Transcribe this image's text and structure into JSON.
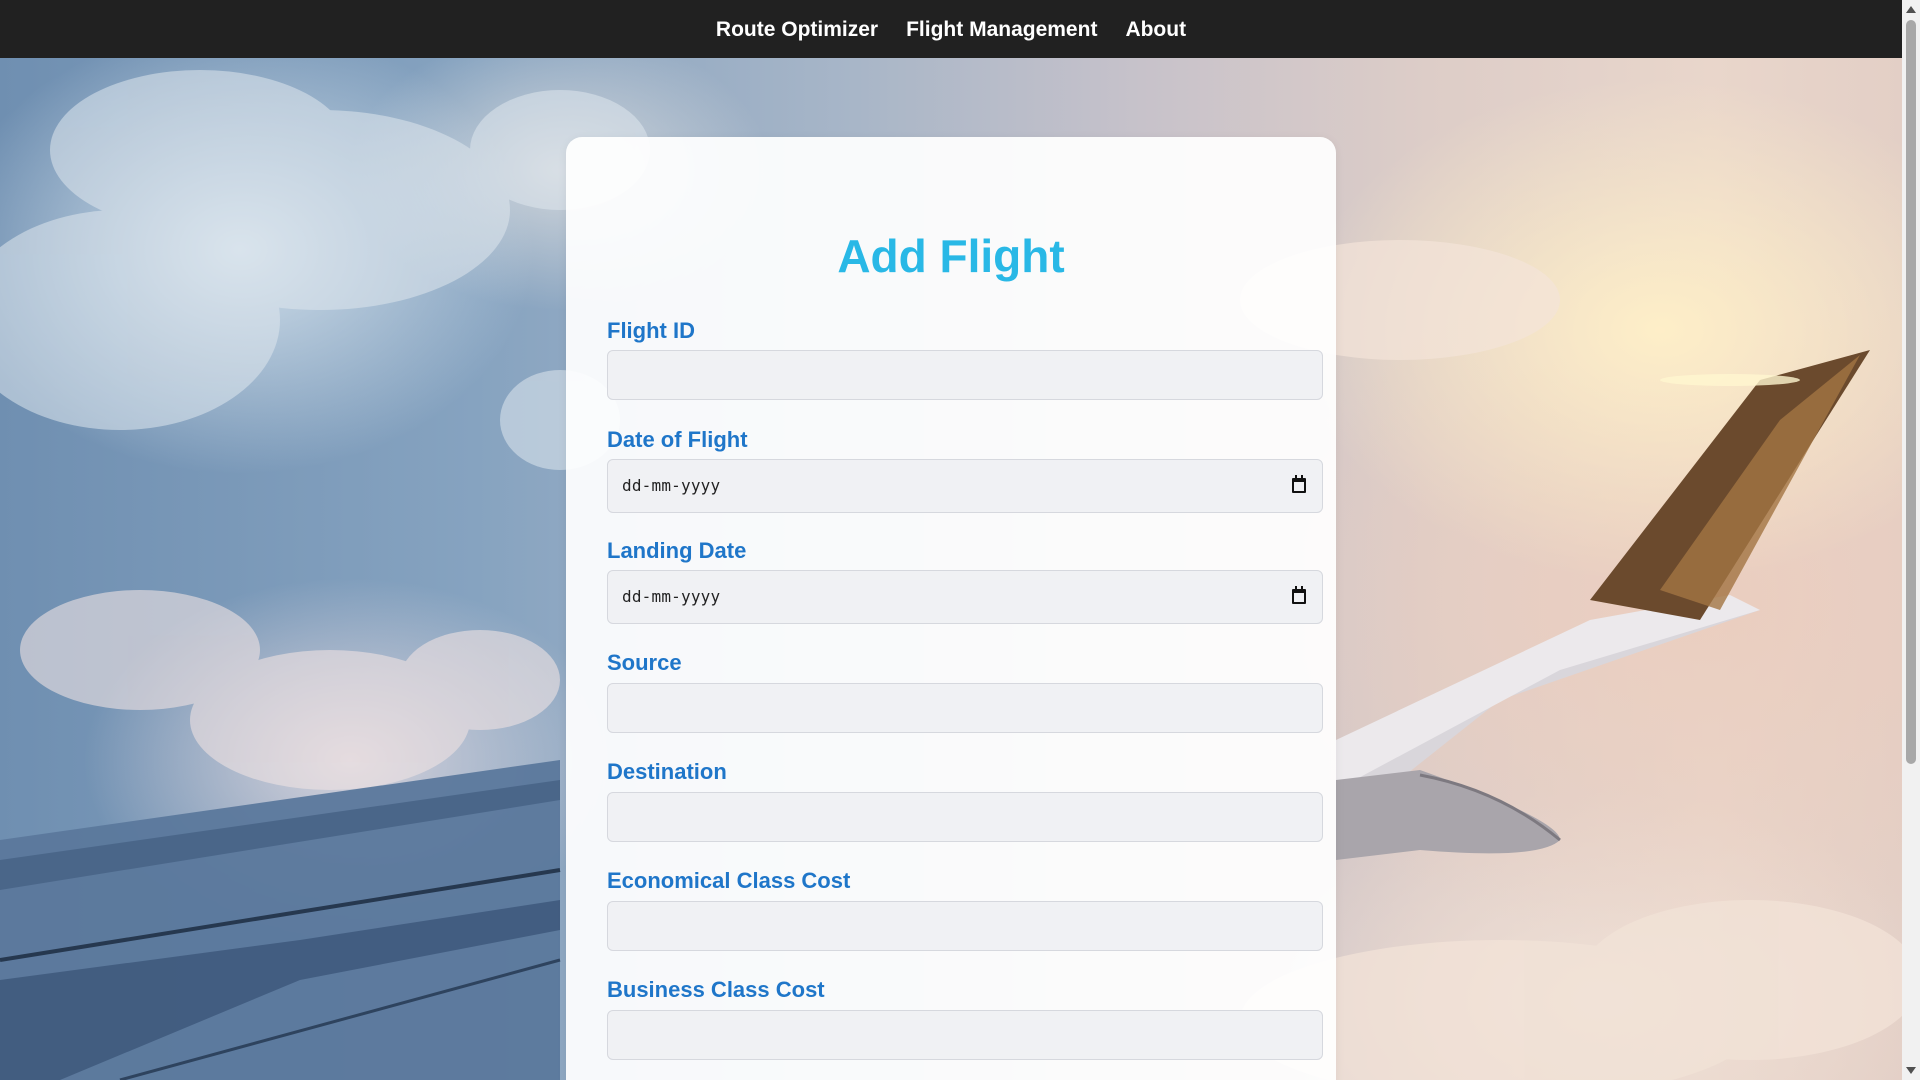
{
  "nav": {
    "items": [
      "Route Optimizer",
      "Flight Management",
      "About"
    ]
  },
  "form": {
    "title": "Add Flight",
    "fields": [
      {
        "label": "Flight ID",
        "value": ""
      },
      {
        "label": "Date of Flight",
        "placeholder": "dd-mm-yyyy"
      },
      {
        "label": "Landing Date",
        "placeholder": "dd-mm-yyyy"
      },
      {
        "label": "Source",
        "value": ""
      },
      {
        "label": "Destination",
        "value": ""
      },
      {
        "label": "Economical Class Cost",
        "value": ""
      },
      {
        "label": "Business Class Cost",
        "value": ""
      }
    ]
  },
  "icons": {
    "date_picker": "calendar-icon"
  },
  "colors": {
    "navbar_bg": "#212121",
    "title": "#29b8e6",
    "label": "#1f76c9",
    "input_bg": "#f0f1f4"
  }
}
